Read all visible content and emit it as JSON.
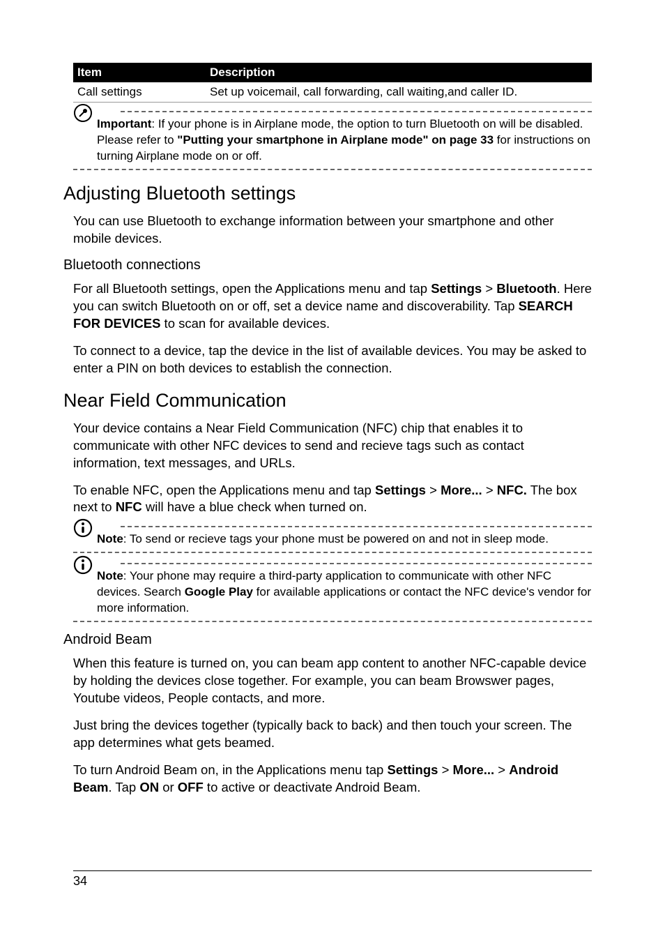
{
  "table": {
    "headers": [
      "Item",
      "Description"
    ],
    "rows": [
      {
        "item": "Call settings",
        "desc": "Set up voicemail, call forwarding, call waiting,and caller ID."
      }
    ]
  },
  "note_important": {
    "label": "Important",
    "text1": ": If your phone is in Airplane mode, the option to turn Bluetooth on will be disabled. Please refer to ",
    "ref": "\"Putting your smartphone in Airplane mode\" on page 33",
    "text2": " for instructions on turning Airplane mode on or off."
  },
  "sec1": {
    "title": "Adjusting Bluetooth settings",
    "p1": "You can use Bluetooth to exchange information between your smartphone and other mobile devices."
  },
  "sub1": {
    "title": "Bluetooth connections",
    "p1a": "For all Bluetooth settings, open the Applications menu and tap ",
    "p1b": "Settings",
    "p1c": " > ",
    "p1d": "Bluetooth",
    "p1e": ". Here you can switch Bluetooth on or off, set a device name and discoverability. Tap ",
    "p1f": "SEARCH FOR DEVICES",
    "p1g": " to scan for available devices.",
    "p2": "To connect to a device, tap the device in the list of available devices. You may be asked to enter a PIN on both devices to establish the connection."
  },
  "sec2": {
    "title": "Near Field Communication",
    "p1": "Your device contains a Near Field Communication (NFC) chip that enables it to communicate with other NFC devices to send and recieve tags such as contact information, text messages, and URLs.",
    "p2a": "To enable NFC, open the Applications menu and tap ",
    "p2b": "Settings",
    "p2c": " > ",
    "p2d": "More...",
    "p2e": " > ",
    "p2f": "NFC.",
    "p2g": " The box next to ",
    "p2h": "NFC",
    "p2i": " will have a blue check when turned on."
  },
  "note_nfc1": {
    "label": "Note",
    "text": ": To send or recieve tags your phone must be powered on and not in sleep mode."
  },
  "note_nfc2": {
    "label": "Note",
    "text1": ": Your phone may require a third-party application to communicate with other NFC devices. Search ",
    "bold": "Google Play",
    "text2": " for available applications or contact the NFC device's vendor for more information."
  },
  "sub2": {
    "title": "Android Beam",
    "p1": "When this feature is turned on, you can beam app content to another NFC-capable device by holding the devices close together. For example, you can beam Browswer pages, Youtube videos, People contacts, and more.",
    "p2": "Just bring the devices together (typically back to back) and then touch your screen. The app determines what gets beamed.",
    "p3a": "To turn Android Beam on, in the Applications menu tap ",
    "p3b": "Settings",
    "p3c": " > ",
    "p3d": "More...",
    "p3e": " > ",
    "p3f": "Android Beam",
    "p3g": ". Tap ",
    "p3h": "ON",
    "p3i": " or ",
    "p3j": "OFF",
    "p3k": " to active or deactivate Android Beam."
  },
  "page_number": "34"
}
